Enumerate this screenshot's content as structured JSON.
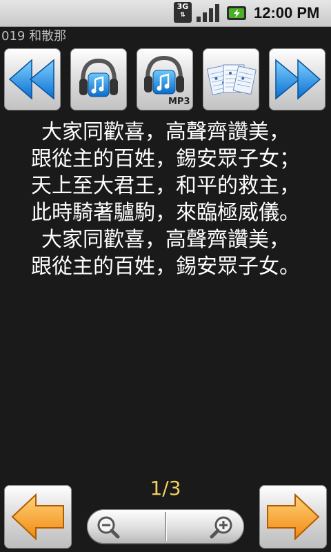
{
  "status_bar": {
    "network": "3G",
    "time": "12:00 PM",
    "icons": [
      "3g-icon",
      "signal-icon",
      "battery-charging-icon"
    ]
  },
  "title": "019 和散那",
  "toolbar": {
    "buttons": [
      {
        "icon": "rewind-icon"
      },
      {
        "icon": "headphones-music-icon"
      },
      {
        "icon": "headphones-mp3-icon",
        "badge": "MP3"
      },
      {
        "icon": "sheet-music-icon"
      },
      {
        "icon": "fast-forward-icon"
      }
    ]
  },
  "lyrics": [
    "大家同歡喜，高聲齊讚美，",
    "跟從主的百姓，錫安眾子女；",
    "天上至大君王，和平的救主，",
    "此時騎著驢駒，來臨極威儀。",
    "大家同歡喜，高聲齊讚美，",
    "跟從主的百姓，錫安眾子女。"
  ],
  "page_indicator": "1/3",
  "nav": {
    "prev_icon": "arrow-left-icon",
    "next_icon": "arrow-right-icon"
  },
  "zoom": {
    "out_icon": "zoom-out-icon",
    "in_icon": "zoom-in-icon"
  },
  "colors": {
    "background": "#1a1a1a",
    "lyrics_text": "#ffffff",
    "page_indicator": "#f0d060",
    "title_text": "#bdbdbd",
    "accent_blue": "#1e88e5",
    "accent_orange": "#f5a21d"
  }
}
